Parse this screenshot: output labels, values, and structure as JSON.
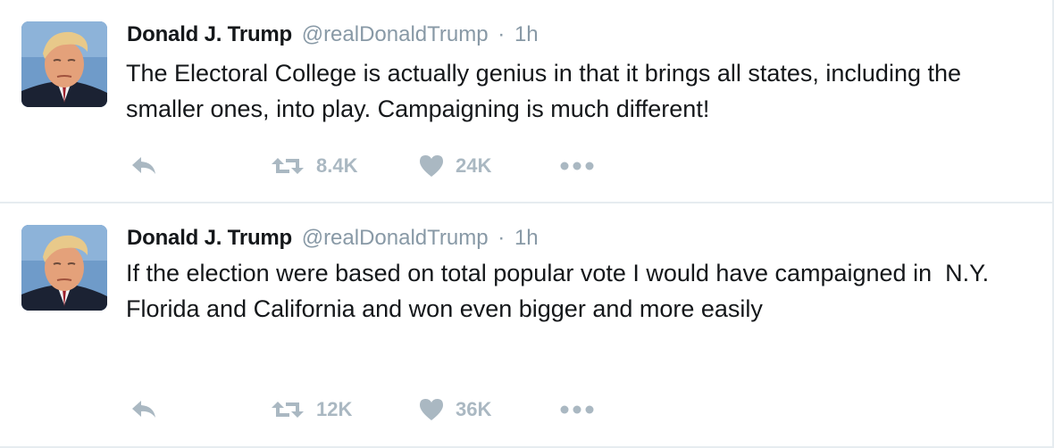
{
  "colors": {
    "text": "#14171a",
    "muted": "#8899a6",
    "action_gray": "#aab8c2",
    "divider": "#e6ecf0"
  },
  "tweets": [
    {
      "author": {
        "name": "Donald J. Trump",
        "handle": "@realDonaldTrump",
        "avatar_icon": "profile-photo"
      },
      "separator": "·",
      "time": "1h",
      "text": "The Electoral College is actually genius in that it brings all states, including the smaller ones, into play. Campaigning is much different!",
      "actions": {
        "reply_icon": "reply-icon",
        "retweet_count": "8.4K",
        "like_count": "24K",
        "more_icon": "more-icon"
      }
    },
    {
      "author": {
        "name": "Donald J. Trump",
        "handle": "@realDonaldTrump",
        "avatar_icon": "profile-photo"
      },
      "separator": "·",
      "time": "1h",
      "text": "If the election were based on total popular vote I would have campaigned in  N.Y. Florida and California and won even bigger and more easily",
      "actions": {
        "reply_icon": "reply-icon",
        "retweet_count": "12K",
        "like_count": "36K",
        "more_icon": "more-icon"
      }
    }
  ]
}
